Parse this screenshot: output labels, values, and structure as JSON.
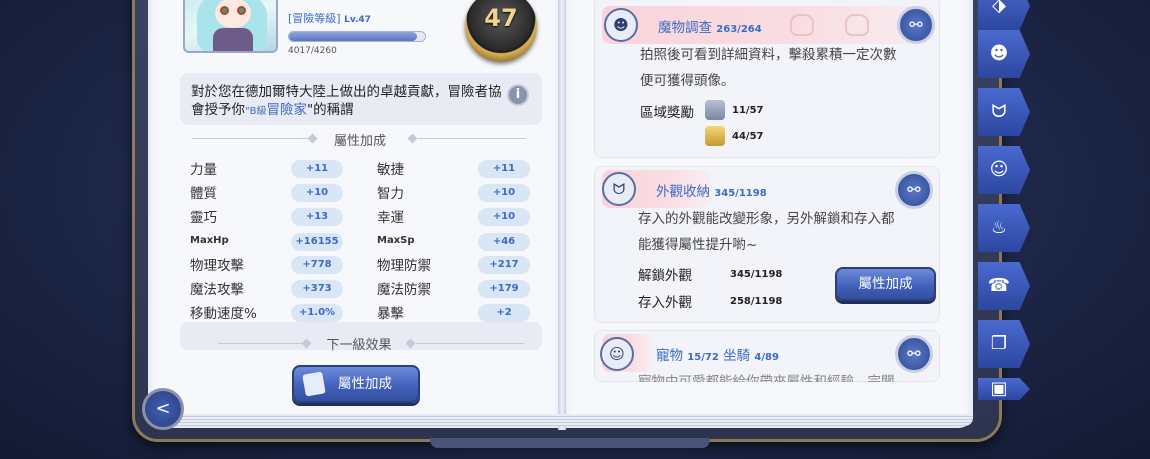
{
  "left_page": {
    "rank_title": "[冒險等級]",
    "rank_level": "Lv.47",
    "exp_text": "4017/4260",
    "exp_progress": 0.943,
    "level_badge": "47",
    "description_prefix": "對於您在德加爾特大陸上做出的卓越貢獻，冒險者協會授予你",
    "description_title_small": "\"B級",
    "description_title": "冒險家",
    "description_suffix": "\"的稱謂",
    "section_attr_bonus": "屬性加成",
    "section_next_effect": "下一級效果",
    "stats": [
      {
        "label": "力量",
        "value": "+11"
      },
      {
        "label": "敏捷",
        "value": "+11"
      },
      {
        "label": "體質",
        "value": "+10"
      },
      {
        "label": "智力",
        "value": "+10"
      },
      {
        "label": "靈巧",
        "value": "+13"
      },
      {
        "label": "幸運",
        "value": "+10"
      },
      {
        "label": "MaxHp",
        "value": "+16155"
      },
      {
        "label": "MaxSp",
        "value": "+46"
      },
      {
        "label": "物理攻擊",
        "value": "+778"
      },
      {
        "label": "物理防禦",
        "value": "+217"
      },
      {
        "label": "魔法攻擊",
        "value": "+373"
      },
      {
        "label": "魔法防禦",
        "value": "+179"
      },
      {
        "label": "移動速度%",
        "value": "+1.0%"
      },
      {
        "label": "暴擊",
        "value": "+2"
      }
    ],
    "attr_button": "屬性加成"
  },
  "right_page": {
    "monster_card": {
      "title": "魔物調查",
      "count": "263/264",
      "text_line1": "拍照後可看到詳細資料，擊殺累積一定次數",
      "text_line2": "便可獲得頭像。",
      "reward_label": "區域獎勵",
      "reward1": "11/57",
      "reward2": "44/57"
    },
    "appearance_card": {
      "title": "外觀收納",
      "count": "345/1198",
      "text_line1": "存入的外觀能改變形象，另外解鎖和存入都",
      "text_line2": "能獲得屬性提升喲~",
      "unlock_label": "解鎖外觀",
      "unlock_value": "345/1198",
      "store_label": "存入外觀",
      "store_value": "258/1198",
      "button": "屬性加成"
    },
    "pet_card": {
      "title1": "寵物",
      "count1": "15/72",
      "title2": "坐騎",
      "count2": "4/89",
      "text_partial": "寵物中可愛都能給你帶來屬性和經驗，完闡"
    }
  },
  "colors": {
    "accent": "#3c6bc4",
    "card_head": "#f9d4da",
    "button": "#4a6ad0"
  }
}
